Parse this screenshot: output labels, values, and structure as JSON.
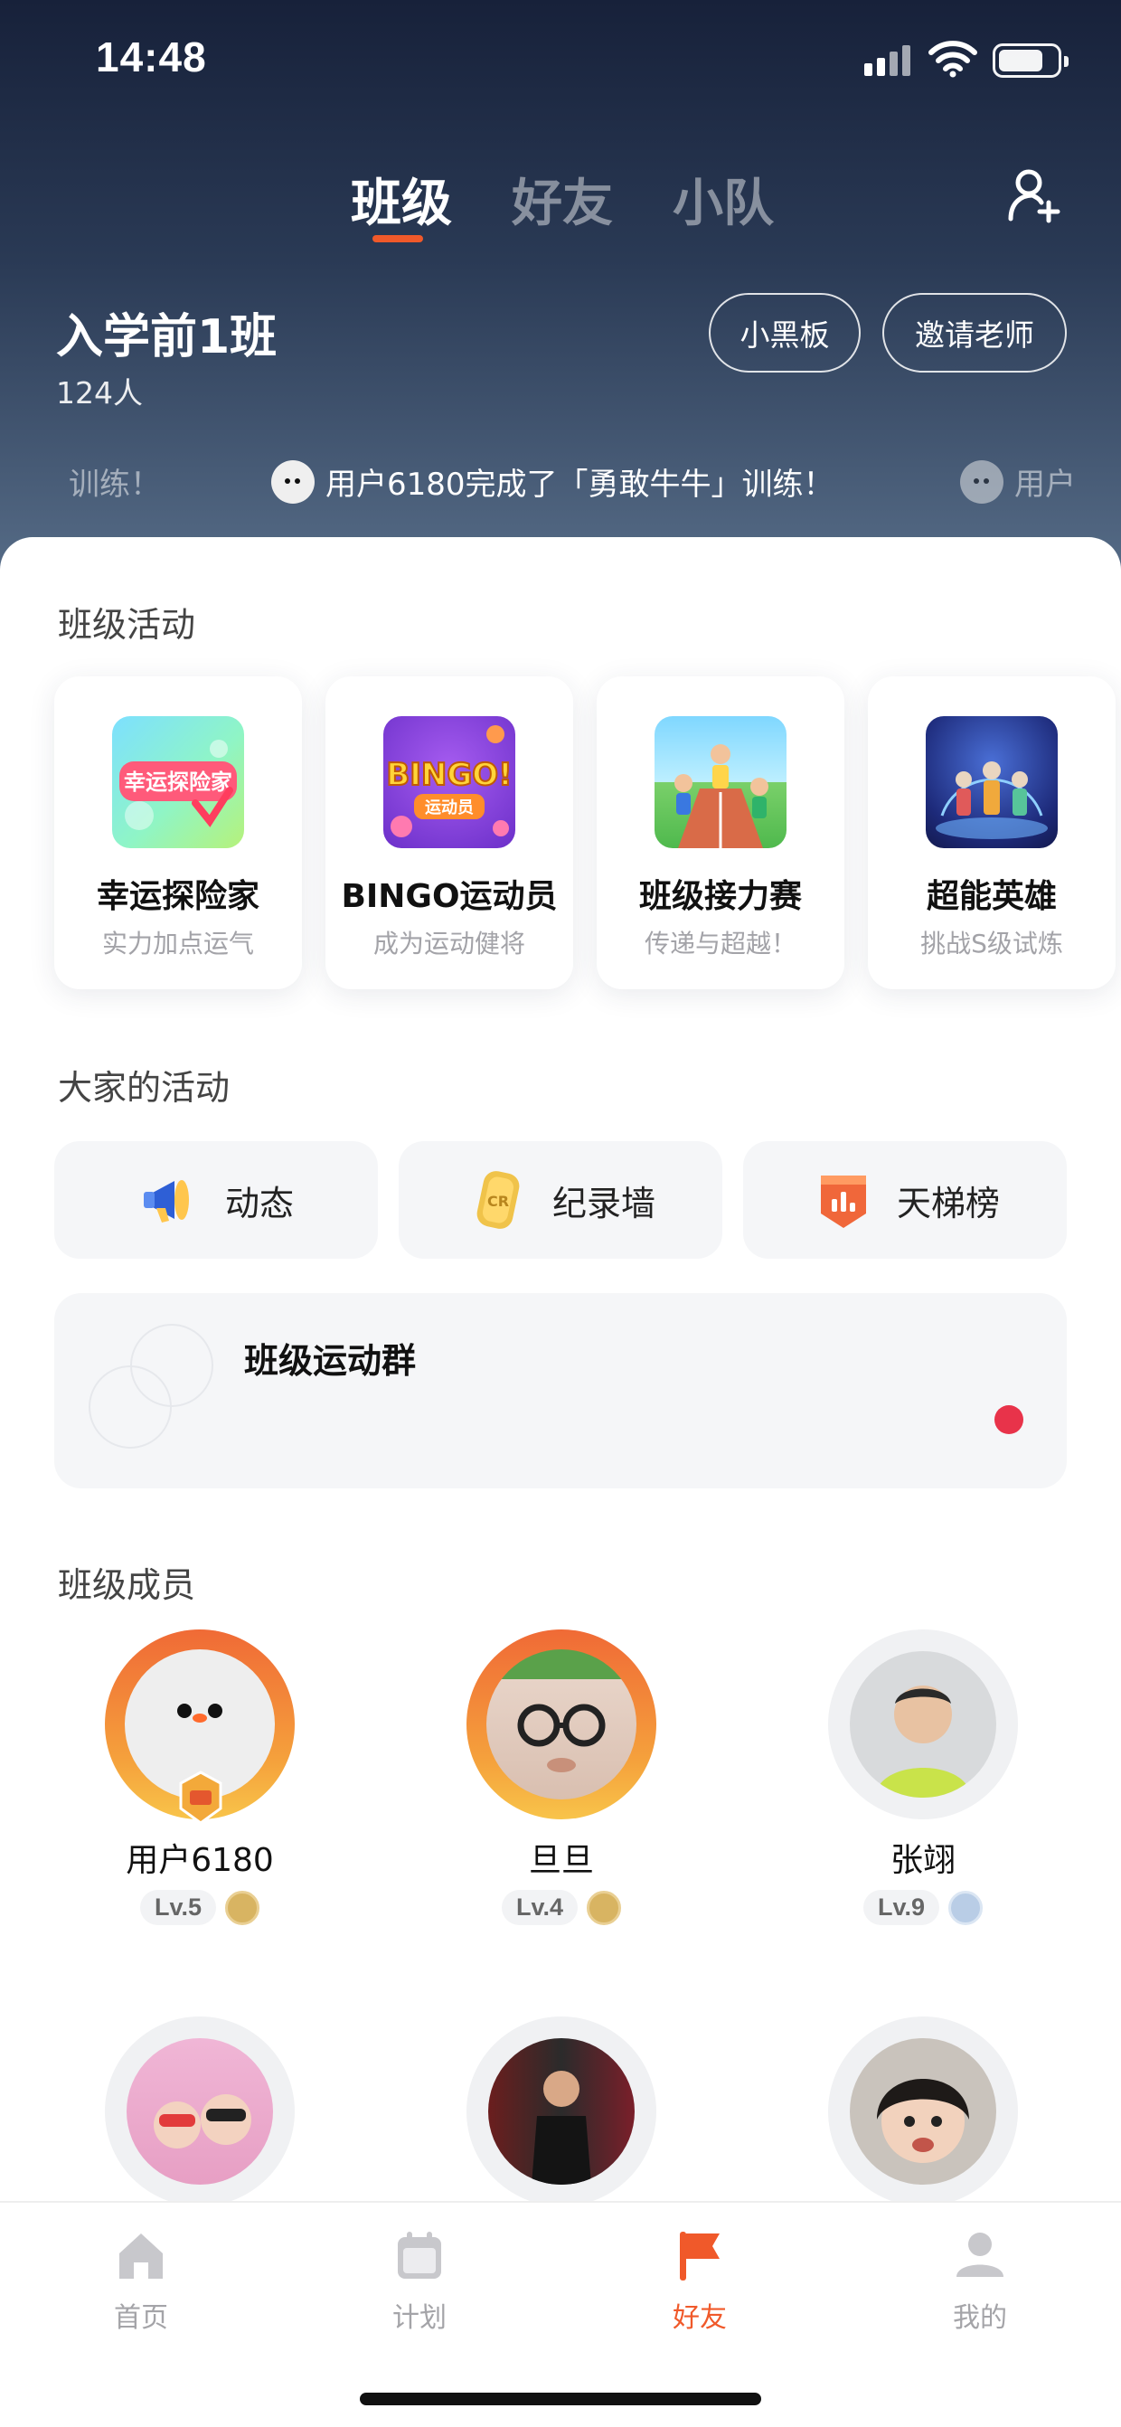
{
  "status_bar": {
    "time": "14:48"
  },
  "top_tabs": [
    {
      "label": "班级",
      "active": true
    },
    {
      "label": "好友",
      "active": false
    },
    {
      "label": "小队",
      "active": false
    }
  ],
  "class_info": {
    "name": "入学前1班",
    "count": "124人"
  },
  "header_buttons": {
    "blackboard": "小黑板",
    "invite": "邀请老师"
  },
  "ticker": {
    "partial_left": "训练！",
    "main": "用户6180完成了「勇敢牛牛」训练！",
    "partial_right": "用户"
  },
  "class_activities": {
    "title": "班级活动",
    "items": [
      {
        "title": "幸运探险家",
        "subtitle": "实力加点运气",
        "image_text": "幸运探险家",
        "icon": "lucky-explorer-icon"
      },
      {
        "title": "BINGO运动员",
        "subtitle": "成为运动健将",
        "image_text": "BINGO!",
        "image_sub": "运动员",
        "icon": "bingo-icon"
      },
      {
        "title": "班级接力赛",
        "subtitle": "传递与超越！",
        "icon": "relay-race-icon"
      },
      {
        "title": "超能英雄",
        "subtitle": "挑战S级试炼",
        "icon": "super-hero-icon"
      }
    ]
  },
  "everyone_activities": {
    "title": "大家的活动",
    "buttons": [
      {
        "label": "动态",
        "icon": "megaphone-icon"
      },
      {
        "label": "纪录墙",
        "icon": "record-card-icon",
        "icon_text": "CR"
      },
      {
        "label": "天梯榜",
        "icon": "ladder-banner-icon"
      }
    ],
    "group": {
      "title": "班级运动群",
      "has_unread": true
    }
  },
  "members": {
    "title": "班级成员",
    "items": [
      {
        "name": "用户6180",
        "level": "Lv.5",
        "ring": "orange",
        "medal": "gold"
      },
      {
        "name": "旦旦",
        "level": "Lv.4",
        "ring": "orange",
        "medal": "gold"
      },
      {
        "name": "张翊",
        "level": "Lv.9",
        "ring": "gray",
        "medal": "silver"
      },
      {
        "name": "",
        "level": "",
        "ring": "gray"
      },
      {
        "name": "",
        "level": "",
        "ring": "gray"
      },
      {
        "name": "",
        "level": "",
        "ring": "gray"
      }
    ]
  },
  "tabbar": [
    {
      "label": "首页",
      "icon": "home-icon",
      "active": false
    },
    {
      "label": "计划",
      "icon": "calendar-icon",
      "active": false
    },
    {
      "label": "好友",
      "icon": "flag-icon",
      "active": true
    },
    {
      "label": "我的",
      "icon": "profile-icon",
      "active": false
    }
  ],
  "colors": {
    "accent": "#f0592a",
    "header_top": "#17213a",
    "header_bottom": "#566c87",
    "unread_dot": "#e8334a"
  }
}
